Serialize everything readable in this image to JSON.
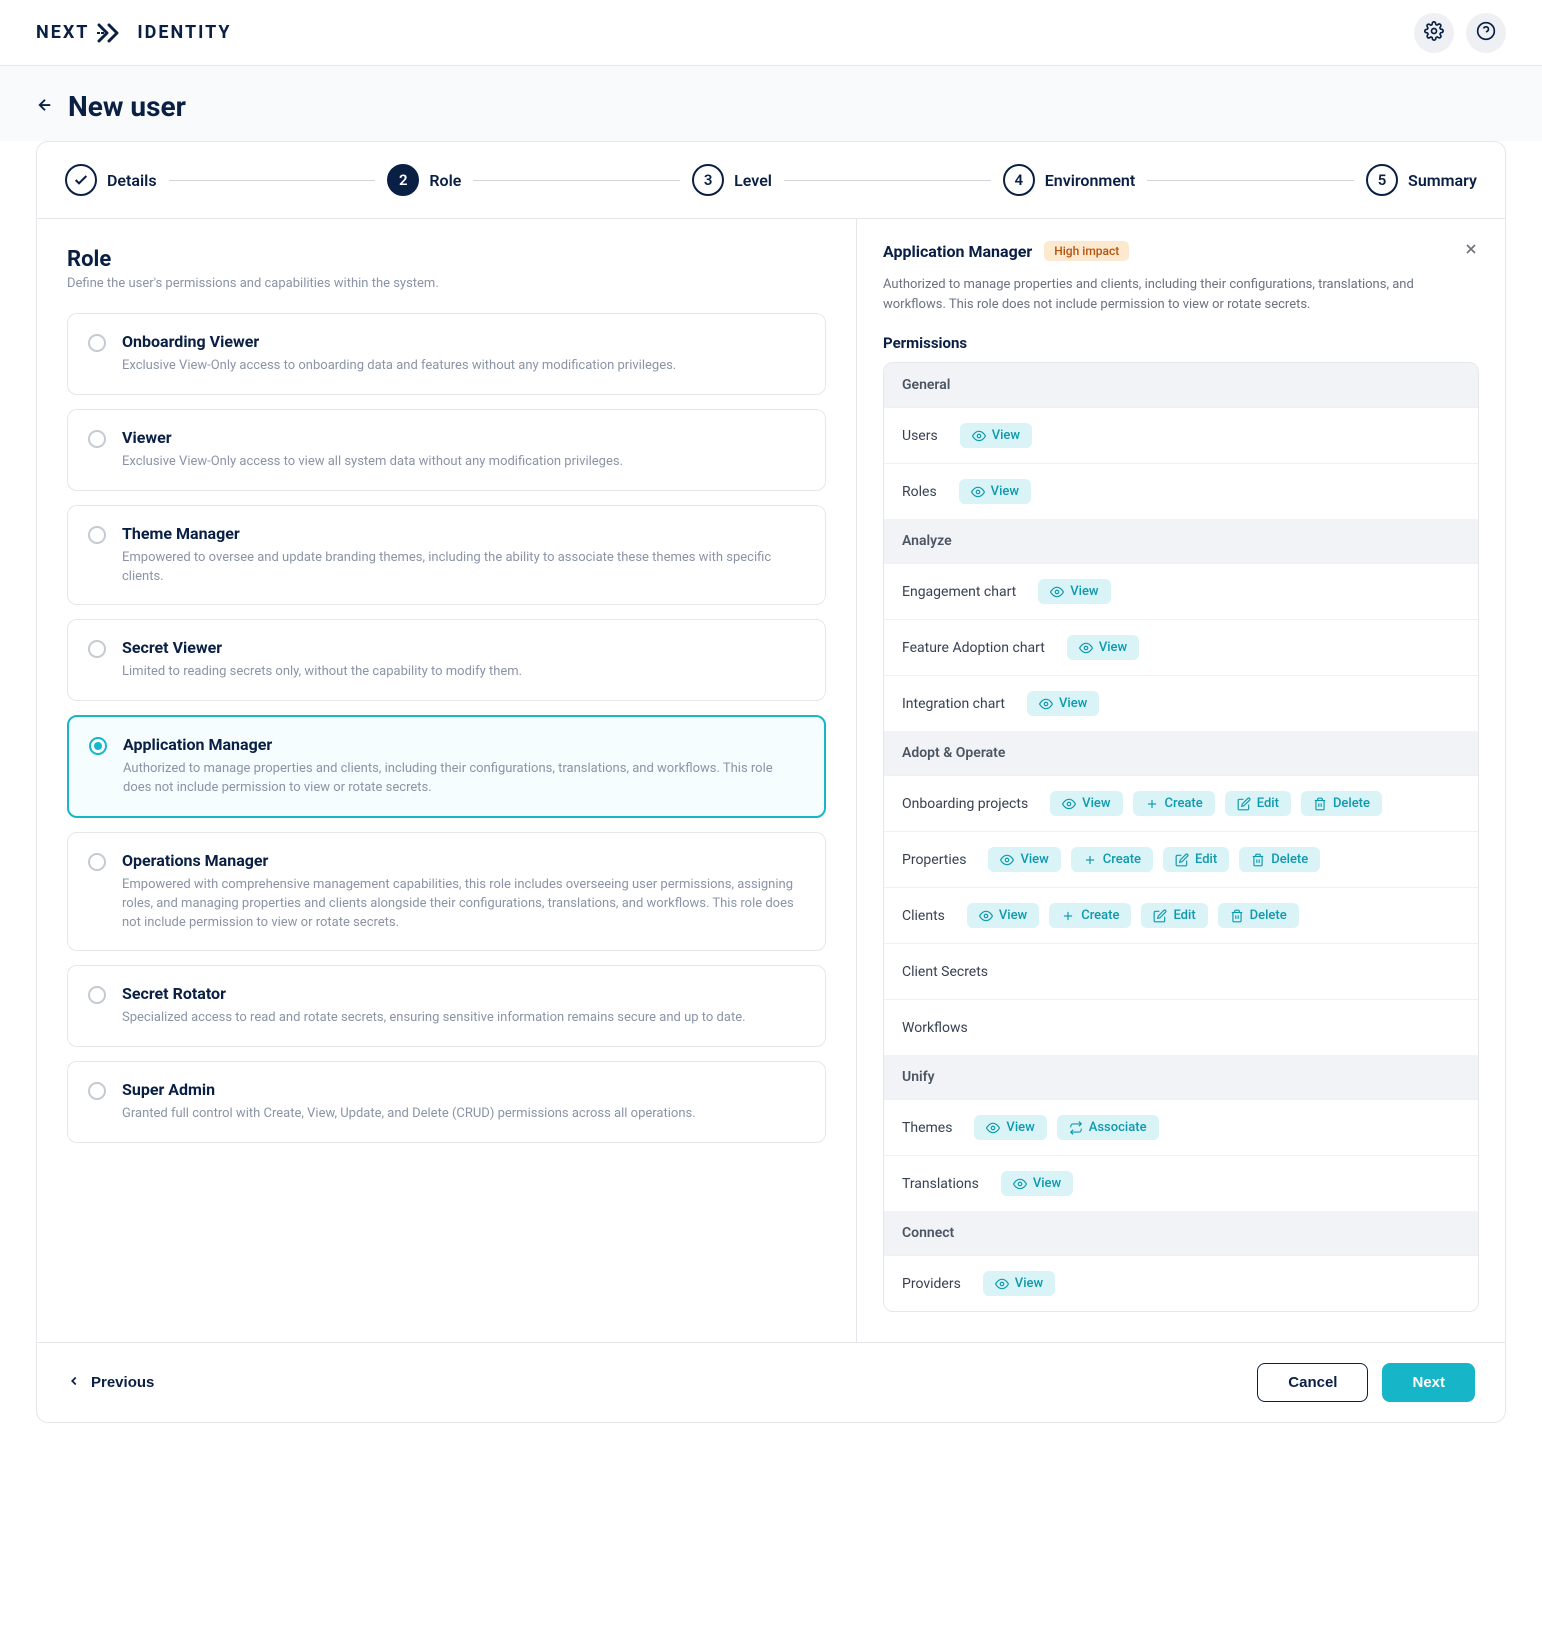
{
  "logo": {
    "word1": "NEXT",
    "word2": "IDENTITY"
  },
  "page_title": "New user",
  "stepper": [
    {
      "label": "Details",
      "state": "done"
    },
    {
      "label": "Role",
      "state": "active",
      "num": "2"
    },
    {
      "label": "Level",
      "state": "pending",
      "num": "3"
    },
    {
      "label": "Environment",
      "state": "pending",
      "num": "4"
    },
    {
      "label": "Summary",
      "state": "pending",
      "num": "5"
    }
  ],
  "role_section": {
    "title": "Role",
    "subtitle": "Define the user's permissions and capabilities within the system."
  },
  "roles": [
    {
      "title": "Onboarding Viewer",
      "desc": "Exclusive View-Only access to onboarding data and features without any modification privileges.",
      "selected": false
    },
    {
      "title": "Viewer",
      "desc": "Exclusive View-Only access to view all system data without any modification privileges.",
      "selected": false
    },
    {
      "title": "Theme Manager",
      "desc": "Empowered to oversee and update branding themes, including the ability to associate these themes with specific clients.",
      "selected": false
    },
    {
      "title": "Secret Viewer",
      "desc": "Limited to reading secrets only, without the capability to modify them.",
      "selected": false
    },
    {
      "title": "Application Manager",
      "desc": "Authorized to manage properties and clients, including their configurations, translations, and workflows. This role does not include permission to view or rotate secrets.",
      "selected": true
    },
    {
      "title": "Operations Manager",
      "desc": "Empowered with comprehensive management capabilities, this role includes overseeing user permissions, assigning roles, and managing properties and clients alongside their configurations, translations, and workflows. This role does not include permission to view or rotate secrets.",
      "selected": false
    },
    {
      "title": "Secret Rotator",
      "desc": "Specialized access to read and rotate secrets, ensuring sensitive information remains secure and up to date.",
      "selected": false
    },
    {
      "title": "Super Admin",
      "desc": "Granted full control with Create, View, Update, and Delete (CRUD) permissions across all operations.",
      "selected": false
    }
  ],
  "detail": {
    "title": "Application Manager",
    "badge": "High impact",
    "desc": "Authorized to manage properties and clients, including their configurations, translations, and workflows. This role does not include permission to view or rotate secrets.",
    "permissions_label": "Permissions"
  },
  "perm_groups": [
    {
      "name": "General",
      "rows": [
        {
          "name": "Users",
          "chips": [
            {
              "icon": "eye",
              "label": "View"
            }
          ]
        },
        {
          "name": "Roles",
          "chips": [
            {
              "icon": "eye",
              "label": "View"
            }
          ]
        }
      ]
    },
    {
      "name": "Analyze",
      "rows": [
        {
          "name": "Engagement chart",
          "chips": [
            {
              "icon": "eye",
              "label": "View"
            }
          ]
        },
        {
          "name": "Feature Adoption chart",
          "chips": [
            {
              "icon": "eye",
              "label": "View"
            }
          ]
        },
        {
          "name": "Integration chart",
          "chips": [
            {
              "icon": "eye",
              "label": "View"
            }
          ]
        }
      ]
    },
    {
      "name": "Adopt & Operate",
      "rows": [
        {
          "name": "Onboarding projects",
          "chips": [
            {
              "icon": "eye",
              "label": "View"
            },
            {
              "icon": "plus",
              "label": "Create"
            },
            {
              "icon": "edit",
              "label": "Edit"
            },
            {
              "icon": "trash",
              "label": "Delete"
            }
          ]
        },
        {
          "name": "Properties",
          "chips": [
            {
              "icon": "eye",
              "label": "View"
            },
            {
              "icon": "plus",
              "label": "Create"
            },
            {
              "icon": "edit",
              "label": "Edit"
            },
            {
              "icon": "trash",
              "label": "Delete"
            }
          ]
        },
        {
          "name": "Clients",
          "chips": [
            {
              "icon": "eye",
              "label": "View"
            },
            {
              "icon": "plus",
              "label": "Create"
            },
            {
              "icon": "edit",
              "label": "Edit"
            },
            {
              "icon": "trash",
              "label": "Delete"
            }
          ]
        },
        {
          "name": "Client Secrets",
          "chips": []
        },
        {
          "name": "Workflows",
          "chips": []
        }
      ]
    },
    {
      "name": "Unify",
      "rows": [
        {
          "name": "Themes",
          "chips": [
            {
              "icon": "eye",
              "label": "View"
            },
            {
              "icon": "swap",
              "label": "Associate"
            }
          ]
        },
        {
          "name": "Translations",
          "chips": [
            {
              "icon": "eye",
              "label": "View"
            }
          ]
        }
      ]
    },
    {
      "name": "Connect",
      "rows": [
        {
          "name": "Providers",
          "chips": [
            {
              "icon": "eye",
              "label": "View"
            }
          ]
        }
      ]
    }
  ],
  "footer": {
    "previous": "Previous",
    "cancel": "Cancel",
    "next": "Next"
  },
  "colors": {
    "accent": "#17b5c8",
    "navy": "#0a1f44",
    "badge_bg": "#fde8d0",
    "badge_fg": "#b45309"
  }
}
